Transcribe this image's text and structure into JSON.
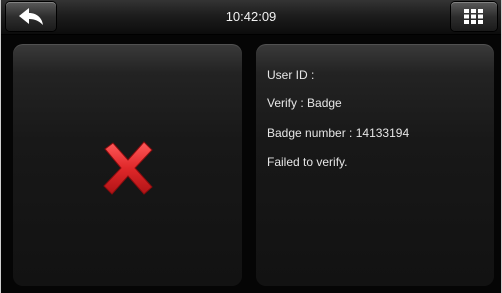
{
  "topbar": {
    "time": "10:42:09",
    "back_icon": "back-arrow-icon",
    "menu_icon": "grid-menu-icon"
  },
  "result": {
    "status_icon": "red-x-fail-icon",
    "status_color": "#e0282a",
    "lines": {
      "user_id": "User ID :",
      "verify": "Verify : Badge",
      "badge_number": "Badge number : 14133194",
      "message": "Failed to verify."
    }
  }
}
